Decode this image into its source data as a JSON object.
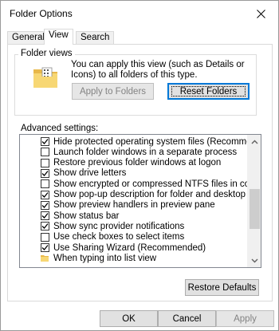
{
  "window": {
    "title": "Folder Options"
  },
  "tabs": [
    {
      "label": "General"
    },
    {
      "label": "View"
    },
    {
      "label": "Search"
    }
  ],
  "folder_views": {
    "legend": "Folder views",
    "description": "You can apply this view (such as Details or Icons) to all folders of this type.",
    "apply_button": "Apply to Folders",
    "reset_button": "Reset Folders"
  },
  "advanced": {
    "label": "Advanced settings:",
    "items": [
      {
        "label": "Hide protected operating system files (Recommended)",
        "type": "checkbox",
        "checked": true
      },
      {
        "label": "Launch folder windows in a separate process",
        "type": "checkbox",
        "checked": false
      },
      {
        "label": "Restore previous folder windows at logon",
        "type": "checkbox",
        "checked": false
      },
      {
        "label": "Show drive letters",
        "type": "checkbox",
        "checked": true
      },
      {
        "label": "Show encrypted or compressed NTFS files in color",
        "type": "checkbox",
        "checked": false
      },
      {
        "label": "Show pop-up description for folder and desktop items",
        "type": "checkbox",
        "checked": true
      },
      {
        "label": "Show preview handlers in preview pane",
        "type": "checkbox",
        "checked": true
      },
      {
        "label": "Show status bar",
        "type": "checkbox",
        "checked": true
      },
      {
        "label": "Show sync provider notifications",
        "type": "checkbox",
        "checked": true
      },
      {
        "label": "Use check boxes to select items",
        "type": "checkbox",
        "checked": false
      },
      {
        "label": "Use Sharing Wizard (Recommended)",
        "type": "checkbox",
        "checked": true
      },
      {
        "label": "When typing into list view",
        "type": "folder"
      }
    ]
  },
  "restore_defaults_button": "Restore Defaults",
  "footer": {
    "ok": "OK",
    "cancel": "Cancel",
    "apply": "Apply"
  },
  "icons": {
    "close": "close-icon",
    "folder": "folder-icon",
    "scroll_up": "scroll-up-icon",
    "scroll_down": "scroll-down-icon",
    "check": "check-icon"
  },
  "colors": {
    "accent": "#0078d7",
    "folder_yellow": "#f7d774",
    "button_face": "#e1e1e1"
  }
}
